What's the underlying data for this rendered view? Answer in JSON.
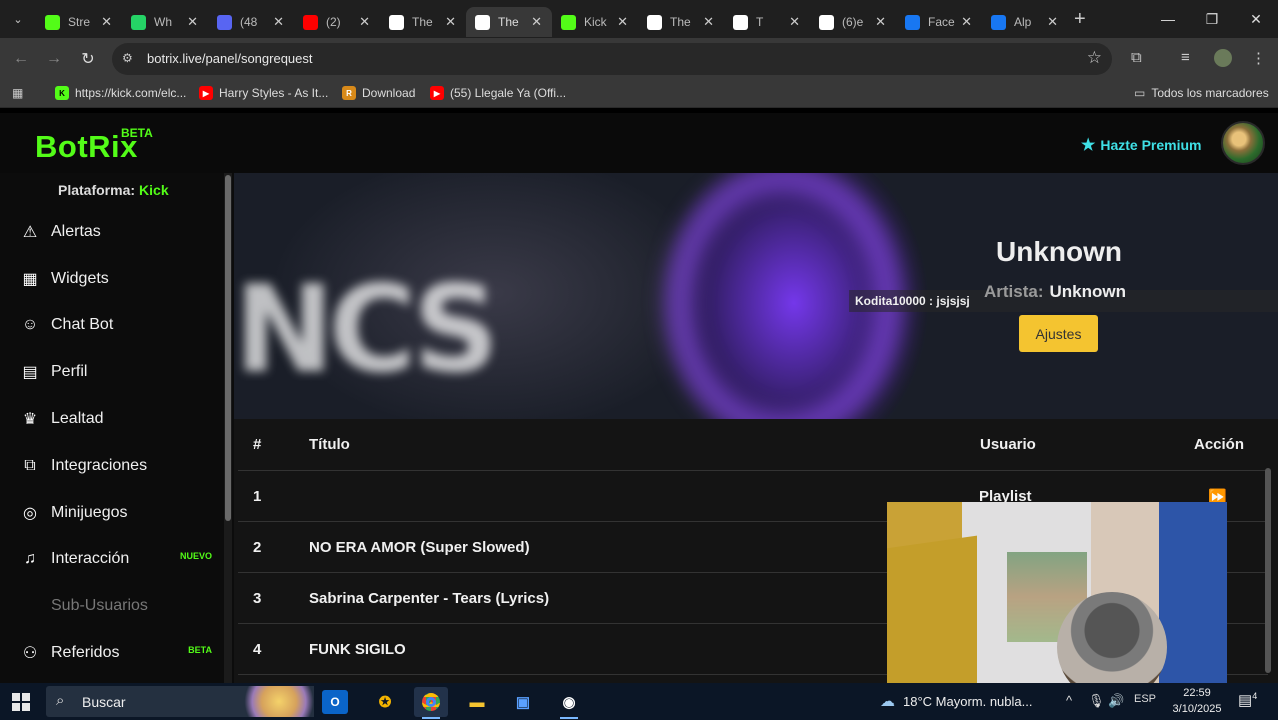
{
  "browser": {
    "tabs": [
      {
        "title": "Stre",
        "icon": "kick-icon",
        "color": "#53fc18"
      },
      {
        "title": "Wh",
        "icon": "whatsapp-icon",
        "color": "#25d366"
      },
      {
        "title": "(48",
        "icon": "discord-icon",
        "color": "#5865f2"
      },
      {
        "title": "(2)",
        "icon": "youtube-icon",
        "color": "#ff0000"
      },
      {
        "title": "The",
        "icon": "botrix-icon",
        "color": "#ffffff"
      },
      {
        "title": "The",
        "icon": "botrix-icon",
        "color": "#ffffff"
      },
      {
        "title": "Kick",
        "icon": "kick-icon",
        "color": "#53fc18"
      },
      {
        "title": "The",
        "icon": "botrix-icon",
        "color": "#ffffff"
      },
      {
        "title": "T",
        "icon": "botrix-icon",
        "color": "#ffffff"
      },
      {
        "title": "(6)e",
        "icon": "tiktok-icon",
        "color": "#ffffff"
      },
      {
        "title": "Face",
        "icon": "facebook-icon",
        "color": "#1877f2"
      },
      {
        "title": "Alp",
        "icon": "facebook-icon",
        "color": "#1877f2"
      }
    ],
    "active_tab_index": 5,
    "url": "botrix.live/panel/songrequest",
    "bookmarks": [
      {
        "label": "https://kick.com/elc...",
        "icon": "kick-icon"
      },
      {
        "label": "Harry Styles - As It...",
        "icon": "youtube-icon"
      },
      {
        "label": "Download",
        "icon": "download-icon"
      },
      {
        "label": "(55) Llegale Ya (Offi...",
        "icon": "youtube-icon"
      }
    ],
    "all_bookmarks_label": "Todos los marcadores"
  },
  "app": {
    "logo": "BotRix",
    "logo_badge": "BETA",
    "premium_label": "Hazte Premium",
    "accent": "#53fc18"
  },
  "sidebar": {
    "platform_label": "Plataforma:",
    "platform_value": "Kick",
    "items": [
      {
        "label": "Alertas",
        "icon": "warning-icon"
      },
      {
        "label": "Widgets",
        "icon": "widgets-icon"
      },
      {
        "label": "Chat Bot",
        "icon": "robot-icon"
      },
      {
        "label": "Perfil",
        "icon": "id-card-icon"
      },
      {
        "label": "Lealtad",
        "icon": "trophy-icon"
      },
      {
        "label": "Integraciones",
        "icon": "integration-icon"
      },
      {
        "label": "Minijuegos",
        "icon": "gamepad-icon"
      },
      {
        "label": "Interacción",
        "icon": "music-icon",
        "tag": "NUEVO"
      },
      {
        "label": "Sub-Usuarios",
        "icon": "",
        "disabled": true
      },
      {
        "label": "Referidos",
        "icon": "users-icon",
        "tag": "BETA"
      }
    ]
  },
  "player": {
    "title": "Unknown",
    "artist_label": "Artista:",
    "artist_value": "Unknown",
    "chat_message": "Kodita10000 : jsjsjsj",
    "settings_button": "Ajustes",
    "banner_text": "NCS"
  },
  "queue": {
    "headers": {
      "num": "#",
      "title": "Título",
      "user": "Usuario",
      "action": "Acción"
    },
    "rows": [
      {
        "num": "1",
        "title": "",
        "user": "Playlist",
        "action": "skip-icon"
      },
      {
        "num": "2",
        "title": "NO ERA AMOR (Super Slowed)",
        "user": "",
        "action": ""
      },
      {
        "num": "3",
        "title": "Sabrina Carpenter - Tears (Lyrics)",
        "user": "",
        "action": ""
      },
      {
        "num": "4",
        "title": "FUNK SIGILO",
        "user": "",
        "action": ""
      }
    ]
  },
  "taskbar": {
    "search_placeholder": "Buscar",
    "weather": "18°C  Mayorm. nubla...",
    "language": "ESP",
    "time": "22:59",
    "date": "3/10/2025",
    "notifications": "4"
  }
}
